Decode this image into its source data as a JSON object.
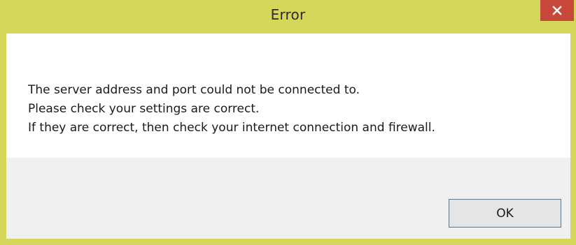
{
  "dialog": {
    "title": "Error",
    "close_icon": "close-icon",
    "message_lines": [
      "The server address and port could not be connected to.",
      "Please check your settings are correct.",
      "If they are correct, then check your internet connection and firewall."
    ],
    "ok_label": "OK"
  },
  "colors": {
    "titlebar": "#d5d75a",
    "close_button": "#c7483a",
    "footer": "#f0f0f0",
    "ok_border": "#3c7fd6"
  }
}
